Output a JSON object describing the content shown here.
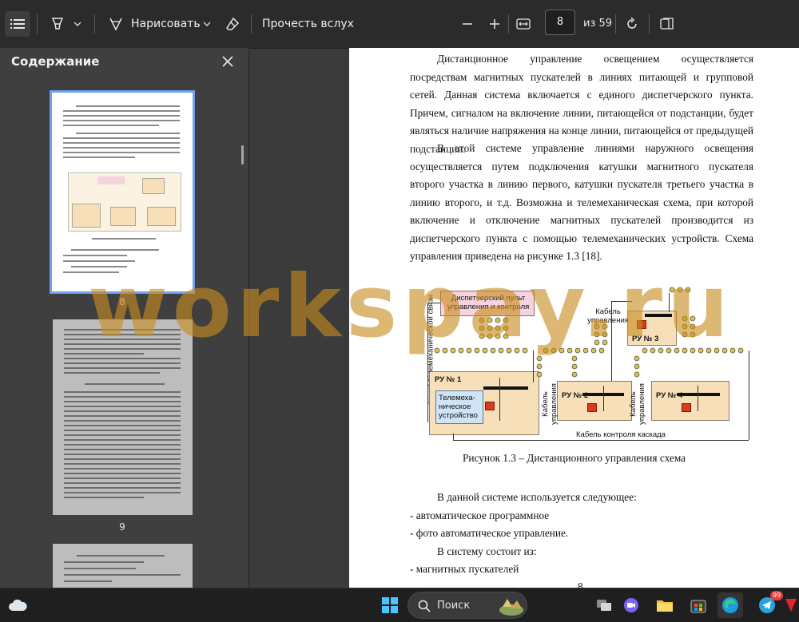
{
  "toolbar": {
    "draw_label": "Нарисовать",
    "read_aloud_label": "Прочесть вслух",
    "page_current": "8",
    "page_total_label": "из 59"
  },
  "sidebar": {
    "title": "Содержание",
    "thumbnails": [
      {
        "label": "8"
      },
      {
        "label": "9"
      }
    ]
  },
  "document": {
    "para1": "Дистанционное управление освещением осуществляется посредствам магнитных пускателей в линиях питающей и групповой сетей. Данная система включается с единого диспетчерского пункта. Причем, сигналом на включение линии, питающейся от подстанции, будет являться наличие напряжения на конце линии, питающейся от предыдущей подстанции.",
    "para2": "В этой системе управление линиями наружного освещения осуществляется путем подключения катушки магнитного пускателя второго участка в линию первого, катушки пускателя третьего участка в линию второго, и т.д. Возможна и телемеханическая схема, при которой включение и отключение магнитных пускателей производится из диспетчерского пункта с помощью телемеханических устройств. Схема управления приведена на рисунке 1.3 [18].",
    "caption": "Рисунок 1.3 – Дистанционного управления схема",
    "lines": [
      "В данной системе используется следующее:",
      "- автоматическое программное",
      "- фото автоматическое управление.",
      "В систему состоит из:",
      "- магнитных пускателей"
    ],
    "page_number": "8",
    "diagram": {
      "dispatch": "Диспетчерский пульт управления и контроля",
      "telemech_line": "Линия телемеханической связи",
      "ru1": "РУ № 1",
      "telemech_device": "Телемеха-ническое устройство",
      "ru2": "РУ № 2",
      "ru3": "РУ № 3",
      "ru4": "РУ № 4",
      "cable_control": "Кабель управления",
      "cable_cascade": "Кабель контроля каскада"
    }
  },
  "watermark": "workspay.ru",
  "taskbar": {
    "search_label": "Поиск",
    "edge_badge": "99"
  },
  "colors": {
    "toolbar_bg": "#2b2b2b",
    "sidebar_bg": "#3f3f3f",
    "selection": "#6f9ff0",
    "ru_box": "#f6dfb9",
    "dispatch_box": "#f6d3de",
    "telemech_box": "#cfe4f6",
    "breaker": "#d93a20",
    "watermark": "#c88c1e"
  }
}
